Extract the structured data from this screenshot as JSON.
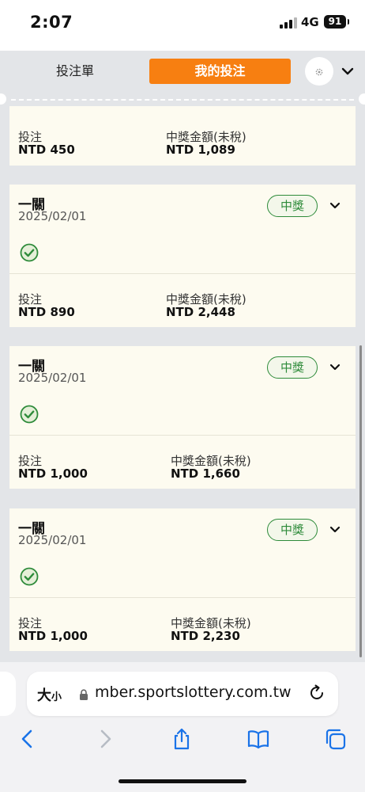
{
  "status_bar": {
    "time": "2:07",
    "network": "4G",
    "battery": "91"
  },
  "header": {
    "tab_slip": "投注單",
    "tab_my_bets": "我的投注",
    "accent": "#f77f11"
  },
  "first_card": {
    "stake_label": "投注",
    "stake": "NTD 450",
    "payout_label": "中獎金額(未稅)",
    "payout": "NTD 1,089"
  },
  "bets": [
    {
      "type": "一關",
      "date": "2025/02/01",
      "status": "中獎",
      "stake_label": "投注",
      "stake": "NTD 890",
      "payout_label": "中獎金額(未稅)",
      "payout": "NTD 2,448"
    },
    {
      "type": "一關",
      "date": "2025/02/01",
      "status": "中獎",
      "stake_label": "投注",
      "stake": "NTD 1,000",
      "payout_label": "中獎金額(未稅)",
      "payout": "NTD 1,660"
    },
    {
      "type": "一關",
      "date": "2025/02/01",
      "status": "中獎",
      "stake_label": "投注",
      "stake": "NTD 1,000",
      "payout_label": "中獎金額(未稅)",
      "payout": "NTD 2,230"
    }
  ],
  "browser": {
    "text_size": "大",
    "text_size_small": "小",
    "url": "mber.sportslottery.com.tw"
  },
  "colors": {
    "win_green": "#2e8b3a",
    "card_bg": "#fdfbf0",
    "ios_blue": "#1a73e8"
  }
}
